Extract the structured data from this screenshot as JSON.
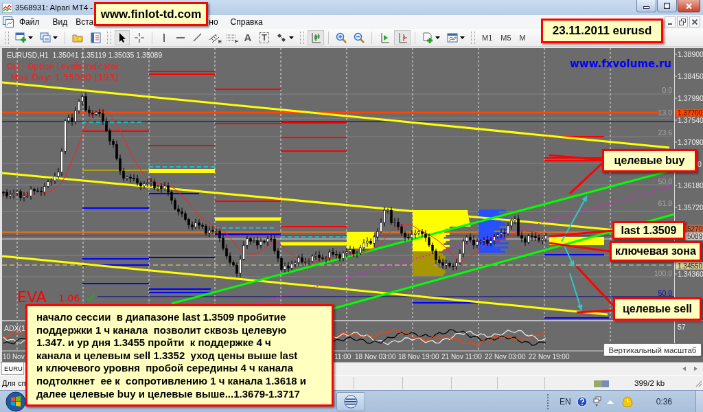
{
  "window": {
    "title": "3568931: Alpari MT4 -"
  },
  "site_banner": "www.finlot-td.com",
  "menu": [
    "Файл",
    "Вид",
    "Вста",
    "но",
    "Справка"
  ],
  "toolbar": [
    {
      "kind": "grip"
    },
    {
      "kind": "newchart",
      "pressed": false
    },
    {
      "kind": "profiles",
      "pressed": false
    },
    {
      "kind": "separator"
    },
    {
      "kind": "favorites",
      "pressed": false
    },
    {
      "kind": "navigator",
      "pressed": false
    },
    {
      "kind": "grip"
    },
    {
      "kind": "cursor",
      "pressed": true
    },
    {
      "kind": "crosshair",
      "pressed": false
    },
    {
      "kind": "separator"
    },
    {
      "kind": "vline",
      "pressed": false
    },
    {
      "kind": "hline",
      "pressed": false
    },
    {
      "kind": "trendline",
      "pressed": false
    },
    {
      "kind": "channel",
      "glyph": "E",
      "pressed": false
    },
    {
      "kind": "fibo",
      "glyph": "F",
      "pressed": false
    },
    {
      "kind": "text",
      "glyph": "A",
      "pressed": false
    },
    {
      "kind": "label",
      "glyph": "T",
      "pressed": false
    },
    {
      "kind": "arrows",
      "pressed": false
    },
    {
      "kind": "grip"
    },
    {
      "kind": "candles",
      "pressed": true
    },
    {
      "kind": "separator"
    },
    {
      "kind": "zoomin",
      "pressed": false
    },
    {
      "kind": "zoomout",
      "pressed": false
    },
    {
      "kind": "separator"
    },
    {
      "kind": "autoscroll",
      "pressed": false
    },
    {
      "kind": "shift",
      "pressed": true
    },
    {
      "kind": "separator"
    },
    {
      "kind": "indicators",
      "pressed": false
    },
    {
      "kind": "periods",
      "pressed": false
    },
    {
      "kind": "grip"
    }
  ],
  "timeframes": [
    "M1",
    "M5",
    "M"
  ],
  "date_banner": "23.11.2011 eurusd",
  "chart": {
    "ohlc_header": "EURUSD,H1  1.35041 1.35119 1.35035 1.35089",
    "indicator_title": "OLI - Option Levels Indicator",
    "max_day": "Max Day: 1.35080 [193]",
    "site_label": "www.fxvolume.ru",
    "eva": {
      "label": "EVA",
      "value": "1.06"
    },
    "fib_labels": [
      {
        "text": "0.0",
        "color": "#a8a8a8"
      },
      {
        "text": "13.0",
        "color": "#a8a8a8"
      },
      {
        "text": "23.6",
        "color": "#a8a8a8"
      },
      {
        "text": "50.0",
        "color": "#a8a8a8"
      },
      {
        "text": "61.8",
        "color": "#a8a8a8"
      },
      {
        "text": "100.0",
        "color": "#a8a8a8"
      },
      {
        "text": "50.0",
        "color": "#0000c8"
      }
    ],
    "price_labels": [
      {
        "text": "1.38900",
        "kind": "plain"
      },
      {
        "text": "1.38450",
        "kind": "plain"
      },
      {
        "text": "1.37990",
        "kind": "plain"
      },
      {
        "text": "1.37700",
        "kind": "tag",
        "color": "#ff4500"
      },
      {
        "text": "1.37540",
        "kind": "plain"
      },
      {
        "text": "1.37090",
        "kind": "plain"
      },
      {
        "text": "0",
        "kind": "plain"
      },
      {
        "text": "1.36180",
        "kind": "plain"
      },
      {
        "text": "1.35720",
        "kind": "plain"
      },
      {
        "text": "5270",
        "kind": "tag",
        "color": "#c8643c"
      },
      {
        "text": "5089",
        "kind": "tag",
        "color": "#d4d4d4"
      },
      {
        "text": "1.34550",
        "kind": "tag",
        "color": "#d8d0a0"
      },
      {
        "text": "1.34360",
        "kind": "plain"
      }
    ],
    "adx_label": "ADX(1",
    "adx_scale": "57",
    "time_labels": [
      "10 Nov",
      "11:00",
      "18 Nov 03:00",
      "18 Nov 19:00",
      "21 Nov 11:00",
      "22 Nov 03:00",
      "22 Nov 19:00"
    ]
  },
  "callouts": [
    "целевые buy",
    "last 1.3509",
    "ключевая зона",
    "целевые sell"
  ],
  "note": "начало сессии  в диапазоне last 1.3509 пробитие\nподдержки 1 ч канала  позволит сквозь целевую\n1.347. и ур дня 1.3455 пройти  к поддержке 4 ч\nканала и целевым sell 1.3352  уход цены выше last\nи ключевого уровня  пробой середины 4 ч канала\nподтолкнет  ее к  сопротивлению 1 ч канала 1.3618 и\nдалее целевые buy и целевые выше...1.3679-1.3717",
  "tooltip": "Вертикальный масштаб",
  "tabs": [
    {
      "label": "EURU",
      "selected": true
    }
  ],
  "status_bar": {
    "hint": "Для сп",
    "traffic": "399/2 kb"
  },
  "taskbar": {
    "language": "EN",
    "clock": "0:36"
  }
}
